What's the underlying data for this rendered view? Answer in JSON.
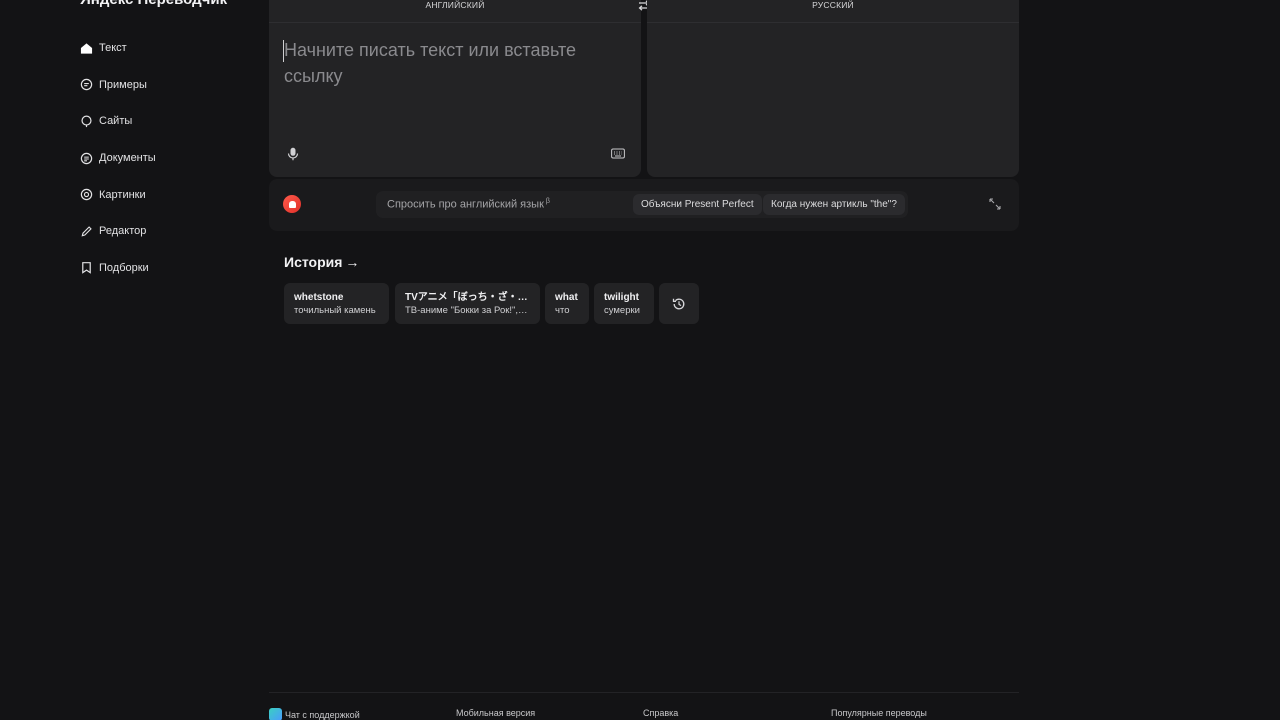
{
  "app": {
    "brand": "Яндекс Переводчик"
  },
  "sidebar": {
    "items": [
      {
        "label": "Текст",
        "icon": "home-icon"
      },
      {
        "label": "Примеры",
        "icon": "chat-icon"
      },
      {
        "label": "Сайты",
        "icon": "globe-icon"
      },
      {
        "label": "Документы",
        "icon": "document-icon"
      },
      {
        "label": "Картинки",
        "icon": "image-icon"
      },
      {
        "label": "Редактор",
        "icon": "pencil-icon"
      },
      {
        "label": "Подборки",
        "icon": "bookmark-icon"
      }
    ]
  },
  "translator": {
    "source_lang": "АНГЛИЙСКИЙ",
    "target_lang": "РУССКИЙ",
    "source_placeholder": "Начните писать текст или вставьте ссылку",
    "swap_icon": "swap-icon",
    "mic_icon": "microphone-icon",
    "keyboard_icon": "keyboard-icon"
  },
  "assistant": {
    "ask_label": "Спросить про английский язык",
    "beta_mark": "β",
    "chips": [
      "Объясни Present Perfect",
      "Когда нужен артикль \"the\"?"
    ],
    "alice_icon": "alice-icon",
    "expand_icon": "expand-icon"
  },
  "history": {
    "title": "История",
    "arrow": "→",
    "items": [
      {
        "word": "whetstone",
        "translation": "точильный камень"
      },
      {
        "word": "TVアニメ「ぼっち・ざ・ロック！」",
        "translation": "ТВ-аниме \"Бокки за Рок!\", \"Одинокий рокер!\""
      },
      {
        "word": "what",
        "translation": "что"
      },
      {
        "word": "twilight",
        "translation": "сумерки"
      }
    ],
    "more_icon": "history-icon"
  },
  "footer": {
    "links": [
      "Чат с поддержкой",
      "Мобильная версия",
      "Справка",
      "Популярные переводы"
    ]
  }
}
